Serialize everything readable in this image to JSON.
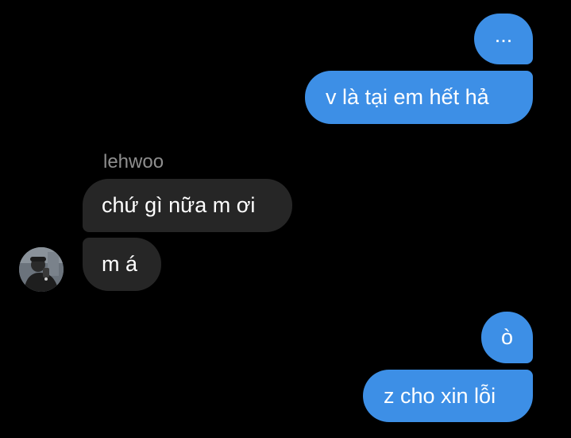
{
  "thread": {
    "contact_name": "lehwoo",
    "messages": [
      {
        "from": "me",
        "text": "..."
      },
      {
        "from": "me",
        "text": "v là tại em hết hả"
      },
      {
        "from": "lehwoo",
        "text": "chứ gì nữa m ơi"
      },
      {
        "from": "lehwoo",
        "text": "m á"
      },
      {
        "from": "me",
        "text": "ò"
      },
      {
        "from": "me",
        "text": "z cho xin lỗi"
      }
    ]
  },
  "colors": {
    "background": "#000000",
    "sent_bubble": "#3d8fe6",
    "received_bubble": "#262626",
    "sender_name": "#8e8e8e"
  },
  "icons": {
    "avatar": "contact-avatar-photo"
  }
}
